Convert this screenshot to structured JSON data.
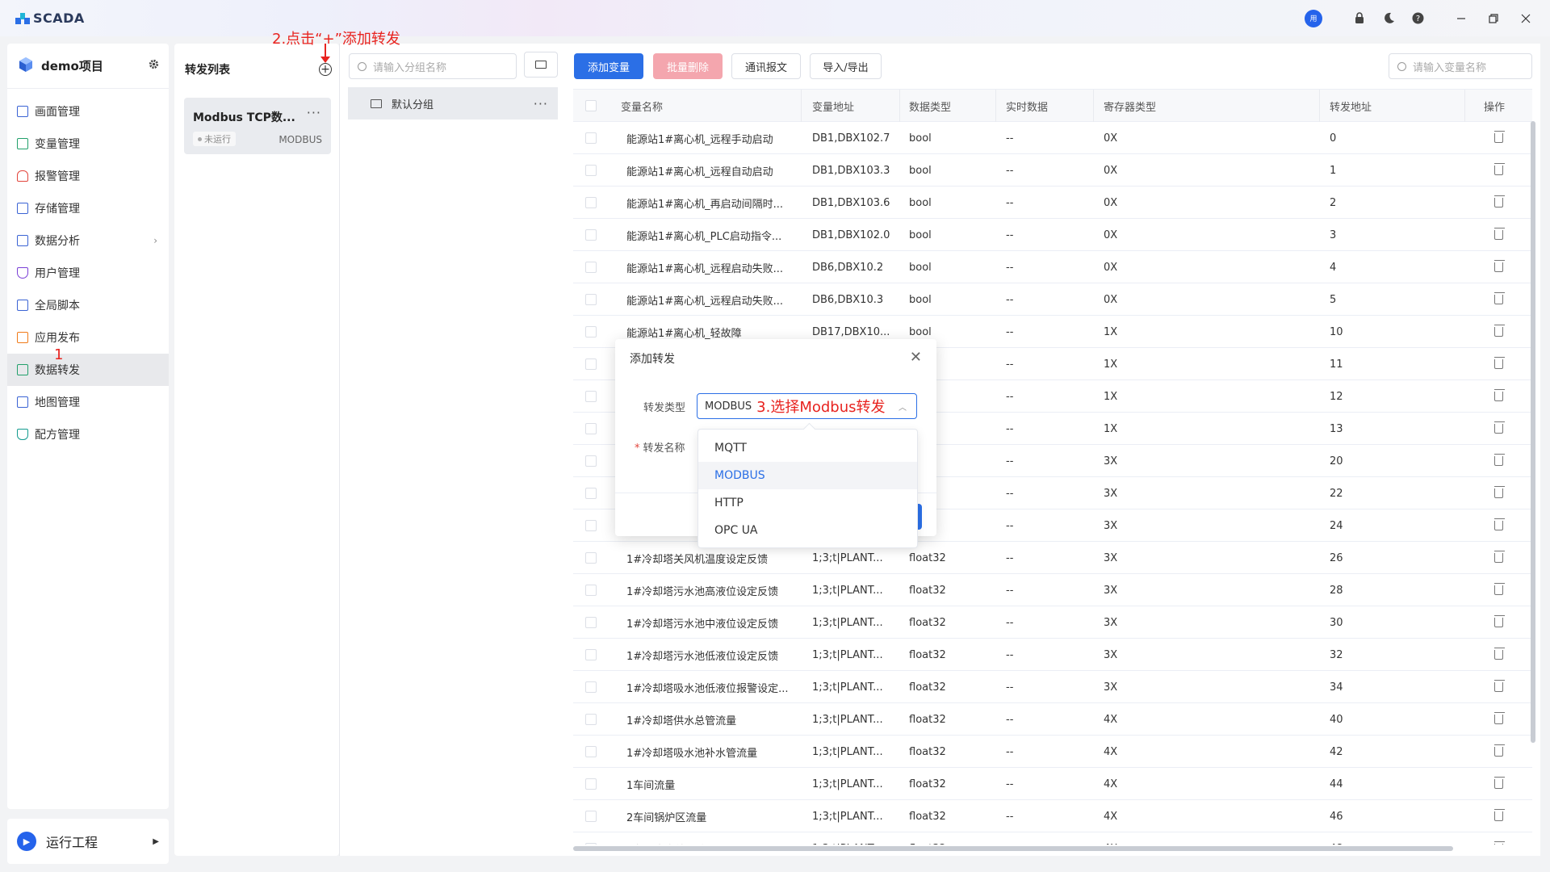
{
  "app": {
    "title": "SCADA",
    "avatar_text": "用"
  },
  "project": {
    "name": "demo项目"
  },
  "nav": {
    "items": [
      {
        "label": "画面管理",
        "icon": "chart-icon"
      },
      {
        "label": "变量管理",
        "icon": "variable-icon"
      },
      {
        "label": "报警管理",
        "icon": "bell-icon"
      },
      {
        "label": "存储管理",
        "icon": "storage-icon"
      },
      {
        "label": "数据分析",
        "icon": "analysis-icon"
      },
      {
        "label": "用户管理",
        "icon": "user-shield-icon"
      },
      {
        "label": "全局脚本",
        "icon": "script-icon"
      },
      {
        "label": "应用发布",
        "icon": "grid-icon"
      },
      {
        "label": "数据转发",
        "icon": "forward-icon"
      },
      {
        "label": "地图管理",
        "icon": "map-icon"
      },
      {
        "label": "配方管理",
        "icon": "flask-icon"
      }
    ],
    "run_label": "运行工程"
  },
  "forward_list": {
    "title": "转发列表",
    "card": {
      "name": "Modbus TCP数...",
      "status": "未运行",
      "protocol": "MODBUS"
    }
  },
  "groups": {
    "search_placeholder": "请输入分组名称",
    "default_group": "默认分组"
  },
  "toolbar": {
    "add_variable": "添加变量",
    "batch_delete": "批量删除",
    "comm_message": "通讯报文",
    "import_export": "导入/导出",
    "search_placeholder": "请输入变量名称"
  },
  "table": {
    "headers": [
      "变量名称",
      "变量地址",
      "数据类型",
      "实时数据",
      "寄存器类型",
      "转发地址",
      "操作"
    ],
    "rows": [
      [
        "能源站1#离心机_远程手动启动",
        "DB1,DBX102.7",
        "bool",
        "--",
        "0X",
        "0"
      ],
      [
        "能源站1#离心机_远程自动启动",
        "DB1,DBX103.3",
        "bool",
        "--",
        "0X",
        "1"
      ],
      [
        "能源站1#离心机_再启动间隔时...",
        "DB1,DBX103.6",
        "bool",
        "--",
        "0X",
        "2"
      ],
      [
        "能源站1#离心机_PLC启动指令...",
        "DB1,DBX102.0",
        "bool",
        "--",
        "0X",
        "3"
      ],
      [
        "能源站1#离心机_远程启动失败...",
        "DB6,DBX10.2",
        "bool",
        "--",
        "0X",
        "4"
      ],
      [
        "能源站1#离心机_远程启动失败...",
        "DB6,DBX10.3",
        "bool",
        "--",
        "0X",
        "5"
      ],
      [
        "能源站1#离心机_轻故障",
        "DB17,DBX10...",
        "bool",
        "--",
        "1X",
        "10"
      ],
      [
        "",
        "",
        "",
        "--",
        "1X",
        "11"
      ],
      [
        "",
        "",
        "",
        "--",
        "1X",
        "12"
      ],
      [
        "",
        "",
        "",
        "--",
        "1X",
        "13"
      ],
      [
        "",
        "",
        "32",
        "--",
        "3X",
        "20"
      ],
      [
        "",
        "",
        "32",
        "--",
        "3X",
        "22"
      ],
      [
        "",
        "",
        "32",
        "--",
        "3X",
        "24"
      ],
      [
        "1#冷却塔关风机温度设定反馈",
        "1;3;t|PLANT...",
        "float32",
        "--",
        "3X",
        "26"
      ],
      [
        "1#冷却塔污水池高液位设定反馈",
        "1;3;t|PLANT...",
        "float32",
        "--",
        "3X",
        "28"
      ],
      [
        "1#冷却塔污水池中液位设定反馈",
        "1;3;t|PLANT...",
        "float32",
        "--",
        "3X",
        "30"
      ],
      [
        "1#冷却塔污水池低液位设定反馈",
        "1;3;t|PLANT...",
        "float32",
        "--",
        "3X",
        "32"
      ],
      [
        "1#冷却塔吸水池低液位报警设定...",
        "1;3;t|PLANT...",
        "float32",
        "--",
        "3X",
        "34"
      ],
      [
        "1#冷却塔供水总管流量",
        "1;3;t|PLANT...",
        "float32",
        "--",
        "4X",
        "40"
      ],
      [
        "1#冷却塔吸水池补水管流量",
        "1;3;t|PLANT...",
        "float32",
        "--",
        "4X",
        "42"
      ],
      [
        "1车间流量",
        "1;3;t|PLANT...",
        "float32",
        "--",
        "4X",
        "44"
      ],
      [
        "2车间锅炉区流量",
        "1;3;t|PLANT...",
        "float32",
        "--",
        "4X",
        "46"
      ],
      [
        "3车间废水处理流量",
        "1;3;t|PLANT...",
        "float32",
        "--",
        "4X",
        "48"
      ]
    ]
  },
  "modal": {
    "title": "添加转发",
    "type_label": "转发类型",
    "name_label": "转发名称",
    "required_mark": "*",
    "selected_value": "MODBUS",
    "options": [
      "MQTT",
      "MODBUS",
      "HTTP",
      "OPC UA"
    ]
  },
  "annotations": {
    "step1": "1",
    "step2": "2.点击“+”添加转发",
    "step3": "3.选择Modbus转发"
  },
  "colors": {
    "primary": "#2b6fe6",
    "danger_disabled": "#f4a6ae",
    "annotation": "#e8231f"
  }
}
